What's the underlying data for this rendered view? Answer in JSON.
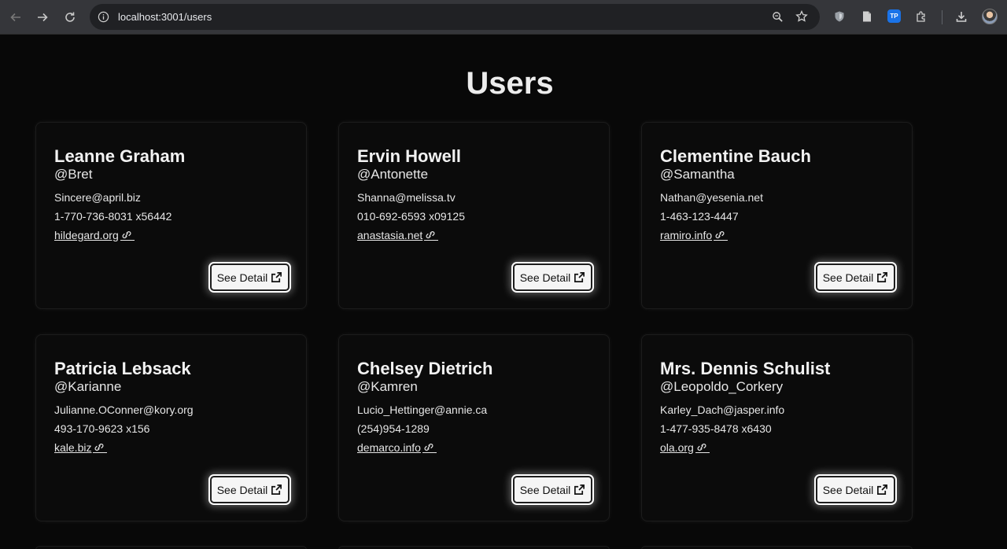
{
  "browser": {
    "url": "localhost:3001/users",
    "tp_badge": "TP"
  },
  "page": {
    "title": "Users",
    "button_label": "See Detail"
  },
  "users": [
    {
      "name": "Leanne Graham",
      "username": "@Bret",
      "email": "Sincere@april.biz",
      "phone": "1-770-736-8031 x56442",
      "website": "hildegard.org"
    },
    {
      "name": "Ervin Howell",
      "username": "@Antonette",
      "email": "Shanna@melissa.tv",
      "phone": "010-692-6593 x09125",
      "website": "anastasia.net"
    },
    {
      "name": "Clementine Bauch",
      "username": "@Samantha",
      "email": "Nathan@yesenia.net",
      "phone": "1-463-123-4447",
      "website": "ramiro.info"
    },
    {
      "name": "Patricia Lebsack",
      "username": "@Karianne",
      "email": "Julianne.OConner@kory.org",
      "phone": "493-170-9623 x156",
      "website": "kale.biz"
    },
    {
      "name": "Chelsey Dietrich",
      "username": "@Kamren",
      "email": "Lucio_Hettinger@annie.ca",
      "phone": "(254)954-1289",
      "website": "demarco.info"
    },
    {
      "name": "Mrs. Dennis Schulist",
      "username": "@Leopoldo_Corkery",
      "email": "Karley_Dach@jasper.info",
      "phone": "1-477-935-8478 x6430",
      "website": "ola.org"
    }
  ],
  "icons": {
    "back": "arrow-left-icon",
    "forward": "arrow-right-icon",
    "reload": "reload-icon",
    "info": "info-icon",
    "zoom": "zoom-icon",
    "bookmark": "star-icon",
    "shield": "shield-icon",
    "doc": "document-icon",
    "puzzle": "puzzle-icon",
    "download": "download-icon",
    "link": "link-icon",
    "external": "external-link-icon"
  }
}
